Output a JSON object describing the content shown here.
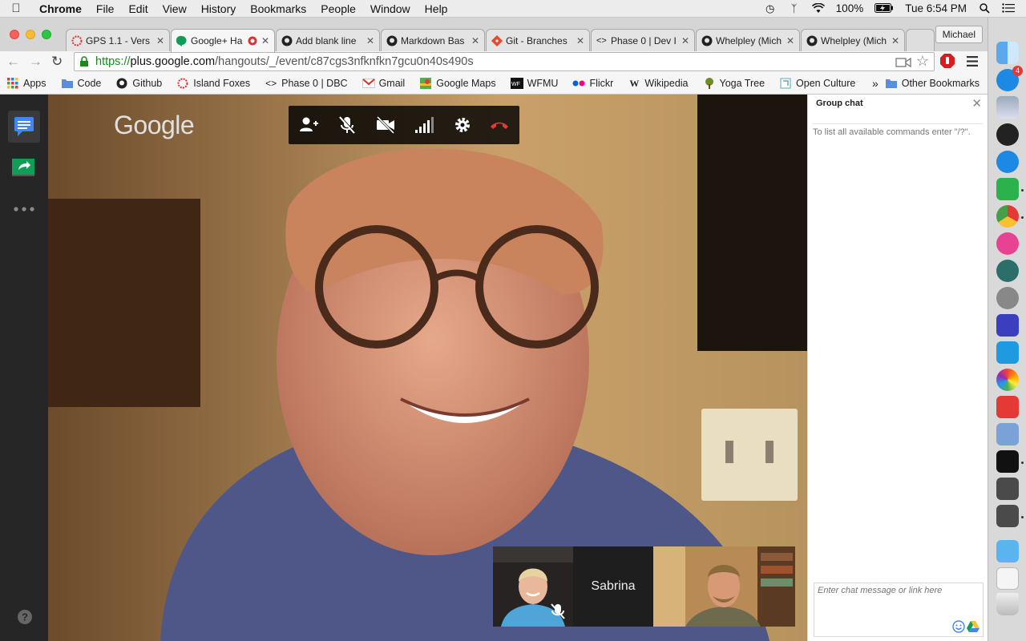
{
  "menubar": {
    "app": "Chrome",
    "items": [
      "File",
      "Edit",
      "View",
      "History",
      "Bookmarks",
      "People",
      "Window",
      "Help"
    ],
    "battery": "100%",
    "clock": "Tue 6:54 PM"
  },
  "tabs": [
    {
      "label": "GPS 1.1 - Vers",
      "icon": "dbc-icon",
      "active": false
    },
    {
      "label": "Google+ Ha",
      "icon": "hangouts-icon",
      "active": true
    },
    {
      "label": "Add blank line",
      "icon": "github-icon",
      "active": false
    },
    {
      "label": "Markdown Bas",
      "icon": "github-icon",
      "active": false
    },
    {
      "label": "Git - Branches",
      "icon": "git-icon",
      "active": false
    },
    {
      "label": "Phase 0 | Dev I",
      "icon": "code-icon",
      "active": false
    },
    {
      "label": "Whelpley (Mich",
      "icon": "github-icon",
      "active": false
    },
    {
      "label": "Whelpley (Mich",
      "icon": "github-icon",
      "active": false
    }
  ],
  "profile": "Michael",
  "omnibox": {
    "scheme": "https://",
    "host": "plus.google.com",
    "path": "/hangouts/_/event/c87cgs3nfknfkn7gcu0n40s490s"
  },
  "bookmarks": [
    {
      "label": "Apps",
      "icon": "apps-grid-icon"
    },
    {
      "label": "Code",
      "icon": "folder-icon"
    },
    {
      "label": "Github",
      "icon": "github-icon"
    },
    {
      "label": "Island Foxes",
      "icon": "dbc-icon"
    },
    {
      "label": "Phase 0 | DBC",
      "icon": "code-icon"
    },
    {
      "label": "Gmail",
      "icon": "gmail-icon"
    },
    {
      "label": "Google Maps",
      "icon": "maps-icon"
    },
    {
      "label": "WFMU",
      "icon": "wfmu-icon"
    },
    {
      "label": "Flickr",
      "icon": "flickr-icon"
    },
    {
      "label": "Wikipedia",
      "icon": "wikipedia-icon"
    },
    {
      "label": "Yoga Tree",
      "icon": "tree-icon"
    },
    {
      "label": "Open Culture",
      "icon": "open-culture-icon"
    }
  ],
  "bookmarks_more": "»",
  "other_bookmarks": "Other Bookmarks",
  "hangout": {
    "logo": "Google",
    "participant_name": "Sabrina",
    "chat_title": "Group chat",
    "chat_hint": "To list all available commands enter \"/?\".",
    "chat_placeholder": "Enter chat message or link here"
  },
  "dock_badge": "4",
  "colors": {
    "hangup": "#e53935",
    "secure": "#1a8a1a",
    "chat_active": "#4285f4",
    "screenshare": "#0f9d58"
  }
}
